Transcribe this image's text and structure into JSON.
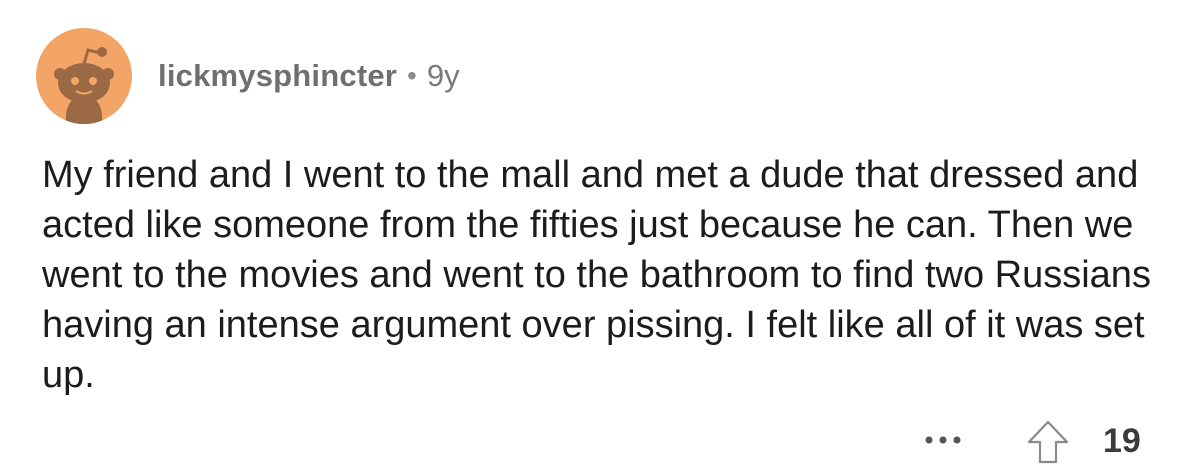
{
  "comment": {
    "author": "lickmysphincter",
    "separator": "•",
    "age": "9y",
    "text": "My friend and I went to the mall and met a dude that dressed and acted like someone from the fifties just because he can. Then we went to the movies and went to the bathroom to find two Russians having an intense argument over pissing. I felt like all of it was set up.",
    "avatar_icon": "reddit-snoo-avatar",
    "avatar_color": "#f2a566",
    "more_icon": "ellipsis-icon",
    "upvote_icon": "upvote-arrow-icon",
    "score": "19"
  }
}
